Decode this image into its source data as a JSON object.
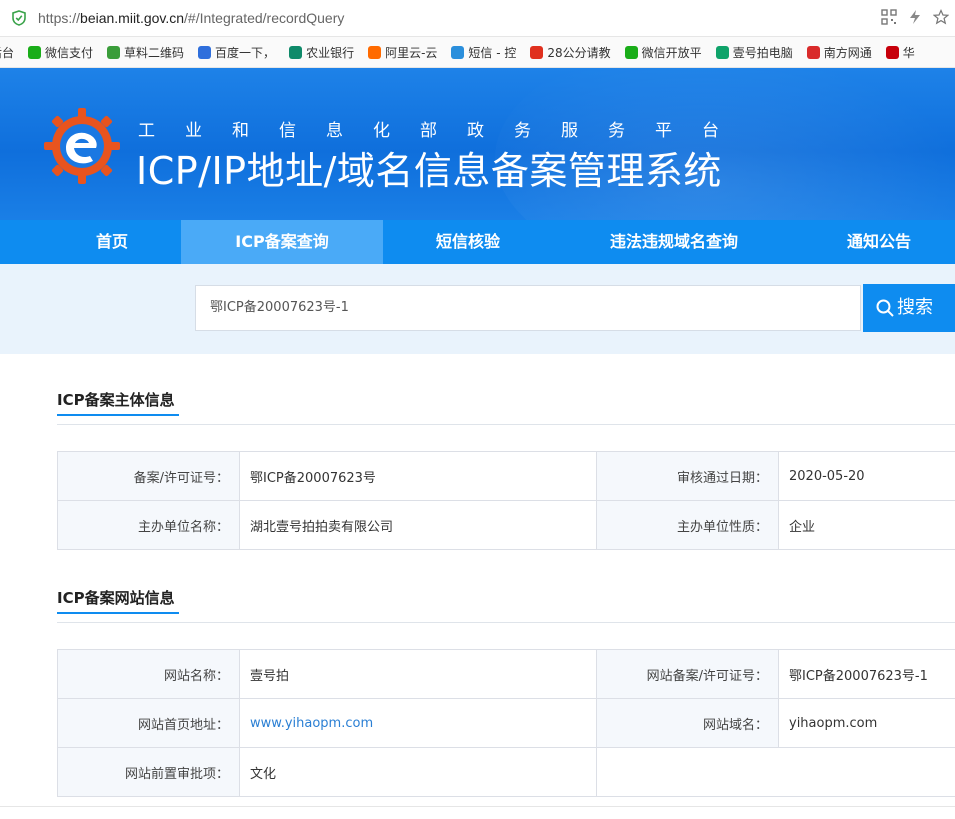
{
  "browser": {
    "url_scheme": "https://",
    "url_host": "beian.miit.gov.cn",
    "url_path": "/#/Integrated/recordQuery",
    "bookmarks": [
      {
        "label": "后台",
        "color": "#e05a2a"
      },
      {
        "label": "微信支付",
        "color": "#1aad19"
      },
      {
        "label": "草料二维码",
        "color": "#3a9d3a"
      },
      {
        "label": "百度一下，",
        "color": "#2f6fdc"
      },
      {
        "label": "农业银行",
        "color": "#0f8a6a"
      },
      {
        "label": "阿里云-云",
        "color": "#ff6a00"
      },
      {
        "label": "短信 - 控",
        "color": "#2b8fdc"
      },
      {
        "label": "28公分请教",
        "color": "#e0301e"
      },
      {
        "label": "微信开放平",
        "color": "#1aad19"
      },
      {
        "label": "壹号拍电脑",
        "color": "#0fa36a"
      },
      {
        "label": "南方网通",
        "color": "#d92b2b"
      },
      {
        "label": "华",
        "color": "#c7000b"
      }
    ]
  },
  "header": {
    "subtitle": "工业和信息化部政务服务平台",
    "title": "ICP/IP地址/域名信息备案管理系统"
  },
  "nav": {
    "items": [
      {
        "label": "首页"
      },
      {
        "label": "ICP备案查询"
      },
      {
        "label": "短信核验"
      },
      {
        "label": "违法违规域名查询"
      },
      {
        "label": "通知公告"
      }
    ],
    "active_index": 1
  },
  "search": {
    "value": "鄂ICP备20007623号-1",
    "button_label": "搜索"
  },
  "subject_section": {
    "title": "ICP备案主体信息",
    "rows": [
      {
        "label1": "备案/许可证号：",
        "value1": "鄂ICP备20007623号",
        "label2": "审核通过日期：",
        "value2": "2020-05-20"
      },
      {
        "label1": "主办单位名称：",
        "value1": "湖北壹号拍拍卖有限公司",
        "label2": "主办单位性质：",
        "value2": "企业"
      }
    ]
  },
  "website_section": {
    "title": "ICP备案网站信息",
    "rows": [
      {
        "label1": "网站名称：",
        "value1": "壹号拍",
        "label2": "网站备案/许可证号：",
        "value2": "鄂ICP备20007623号-1"
      },
      {
        "label1": "网站首页地址：",
        "value1": "www.yihaopm.com",
        "label2": "网站域名：",
        "value2": "yihaopm.com"
      },
      {
        "label1": "网站前置审批项：",
        "value1": "文化",
        "label2": "",
        "value2": ""
      }
    ]
  },
  "colors": {
    "primary": "#0e8cf0",
    "nav_active": "#4aaaf7",
    "link": "#2a7fd4"
  }
}
